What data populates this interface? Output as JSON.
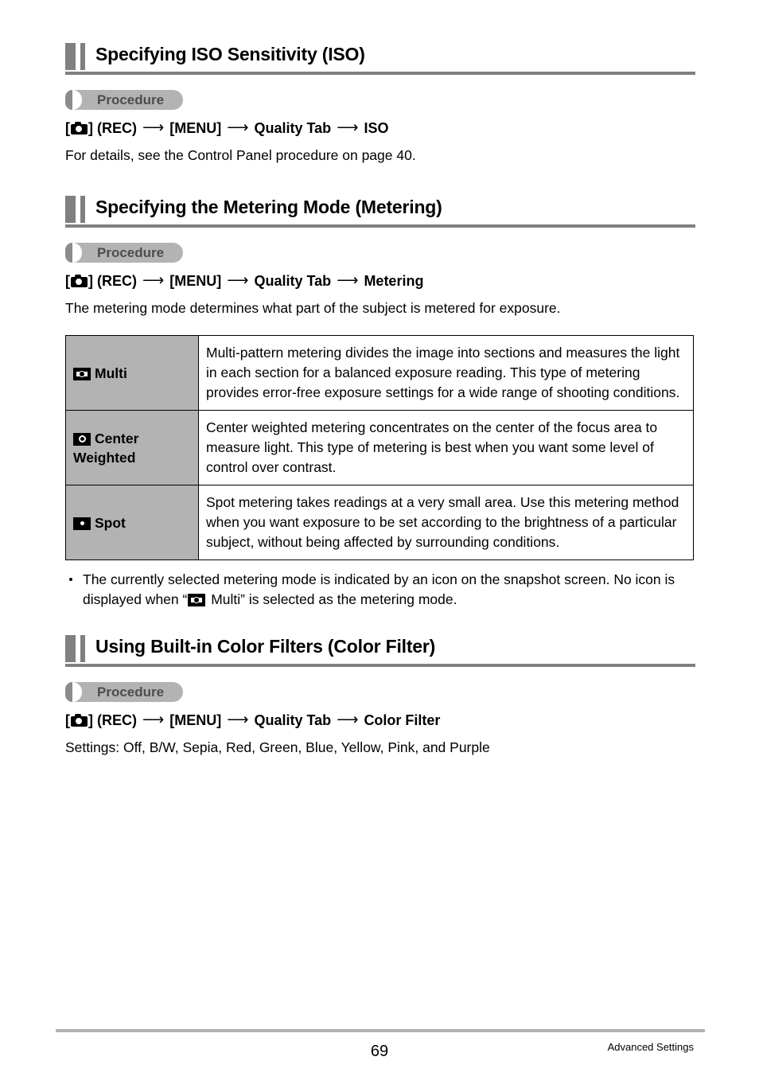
{
  "page": {
    "number": "69",
    "chapter": "Advanced Settings"
  },
  "procedure_label": "Procedure",
  "arrow": "⟶",
  "sections": [
    {
      "title": "Specifying ISO Sensitivity (ISO)",
      "procedure_label": "Procedure",
      "path": {
        "rec": "] (REC)",
        "menu": "[MENU]",
        "tab": "Quality Tab",
        "item": "ISO"
      },
      "body": "For details, see the Control Panel procedure on page 40."
    },
    {
      "title": "Specifying the Metering Mode (Metering)",
      "procedure_label": "Procedure",
      "path": {
        "rec": "] (REC)",
        "menu": "[MENU]",
        "tab": "Quality Tab",
        "item": "Metering"
      },
      "body": "The metering mode determines what part of the subject is metered for exposure."
    },
    {
      "title": "Using Built-in Color Filters (Color Filter)",
      "procedure_label": "Procedure",
      "path": {
        "rec": "] (REC)",
        "menu": "[MENU]",
        "tab": "Quality Tab",
        "item": "Color Filter"
      },
      "body": "Settings: Off, B/W, Sepia, Red, Green, Blue, Yellow, Pink, and Purple"
    }
  ],
  "metering_table": {
    "rows": [
      {
        "icon": "multi-metering-icon",
        "label": "Multi",
        "description": "Multi-pattern metering divides the image into sections and measures the light in each section for a balanced exposure reading. This type of metering provides error-free exposure settings for a wide range of shooting conditions."
      },
      {
        "icon": "center-weighted-metering-icon",
        "label": "Center Weighted",
        "description": "Center weighted metering concentrates on the center of the focus area to measure light. This type of metering is best when you want some level of control over contrast."
      },
      {
        "icon": "spot-metering-icon",
        "label": "Spot",
        "description": "Spot metering takes readings at a very small area. Use this metering method when you want exposure to be set according to the brightness of a particular subject, without being affected by surrounding conditions."
      }
    ]
  },
  "note": {
    "part1": "The currently selected metering mode is indicated by an icon on the snapshot screen. No icon is displayed when “",
    "part2": " Multi” is selected as the metering mode."
  },
  "colors": {
    "accent_gray": "#808080",
    "badge_gray": "#b3b3b3",
    "badge_bar": "#8c8c8c",
    "badge_text": "#4d4d4d",
    "table_header_bg": "#b3b3b3",
    "rule_gray": "#b3b3b3"
  }
}
